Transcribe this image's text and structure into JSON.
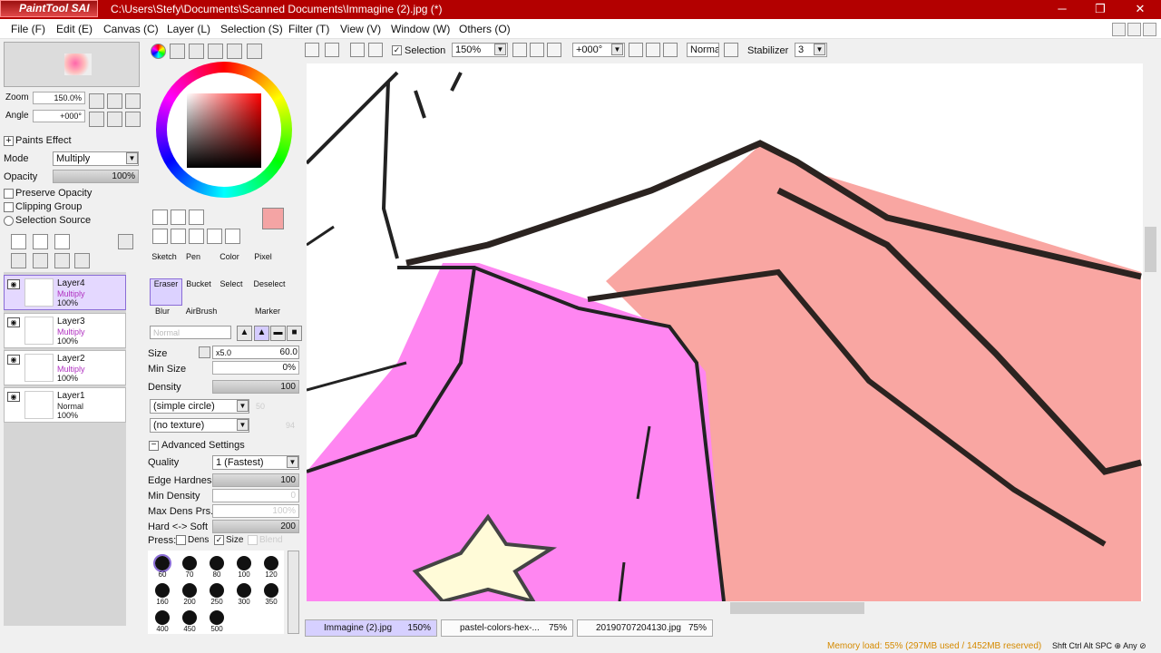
{
  "window": {
    "app_logo": "PaintTool SAI",
    "title": "C:\\Users\\Stefy\\Documents\\Scanned Documents\\Immagine (2).jpg (*)",
    "minimize": "─",
    "restore": "❐",
    "close": "✕"
  },
  "menu": [
    "File (F)",
    "Edit (E)",
    "Canvas (C)",
    "Layer (L)",
    "Selection (S)",
    "Filter (T)",
    "View (V)",
    "Window (W)",
    "Others (O)"
  ],
  "navigator": {
    "zoom_label": "Zoom",
    "zoom_value": "150.0%",
    "angle_label": "Angle",
    "angle_value": "+000°"
  },
  "layer_panel": {
    "paints_effect": "Paints Effect",
    "mode_label": "Mode",
    "mode_value": "Multiply",
    "opacity_label": "Opacity",
    "opacity_value": "100%",
    "opacity_level": 1.0,
    "preserve_opacity": "Preserve Opacity",
    "clipping_group": "Clipping Group",
    "selection_source": "Selection Source"
  },
  "layers": [
    {
      "name": "Layer4",
      "mode": "Multiply",
      "opacity": "100%",
      "selected": true
    },
    {
      "name": "Layer3",
      "mode": "Multiply",
      "opacity": "100%",
      "selected": false
    },
    {
      "name": "Layer2",
      "mode": "Multiply",
      "opacity": "100%",
      "selected": false
    },
    {
      "name": "Layer1",
      "mode": "Normal",
      "opacity": "100%",
      "selected": false
    }
  ],
  "color": {
    "primary": "#f4a4a4",
    "accent": "#7a5cff"
  },
  "tools": {
    "row1": [
      "Sketch",
      "Pen",
      "Color",
      "Pixel"
    ],
    "row2": [
      "Eraser",
      "Bucket",
      "Select",
      "Deselect"
    ],
    "row3": [
      "Blur",
      "AirBrush",
      "",
      "Marker"
    ]
  },
  "brush": {
    "blend": "Normal",
    "size_label": "Size",
    "size_mult": "x5.0",
    "size_value": "60.0",
    "min_size_label": "Min Size",
    "min_size_value": "0%",
    "density_label": "Density",
    "density_value": "100",
    "shape": "(simple circle)",
    "shape_value": "50",
    "texture": "(no texture)",
    "texture_value": "94",
    "advanced": "Advanced Settings",
    "quality_label": "Quality",
    "quality_value": "1 (Fastest)",
    "edge_label": "Edge Hardness",
    "edge_value": "100",
    "min_density_label": "Min Density",
    "min_density_value": "0",
    "max_dens_label": "Max Dens Prs.",
    "max_dens_value": "100%",
    "hardsoft_label": "Hard <-> Soft",
    "hardsoft_value": "200",
    "press_label": "Press:",
    "press_dens": "Dens",
    "press_size": "Size",
    "press_blend": "Blend",
    "sizes": [
      "60",
      "70",
      "80",
      "100",
      "120",
      "160",
      "200",
      "250",
      "300",
      "350",
      "400",
      "450",
      "500"
    ]
  },
  "canvas_toolbar": {
    "selection": "Selection",
    "zoom": "150%",
    "angle": "+000°",
    "blend": "Normal",
    "stabilizer_label": "Stabilizer",
    "stabilizer": "3"
  },
  "tabs": [
    {
      "name": "Immagine (2).jpg",
      "zoom": "150%"
    },
    {
      "name": "pastel-colors-hex-...",
      "zoom": "75%"
    },
    {
      "name": "20190707204130.jpg",
      "zoom": "75%"
    }
  ],
  "status": {
    "memory": "Memory load: 55% (297MB used / 1452MB reserved)",
    "keys": "Shft Ctrl Alt SPC ⊕ Any ⊘"
  }
}
